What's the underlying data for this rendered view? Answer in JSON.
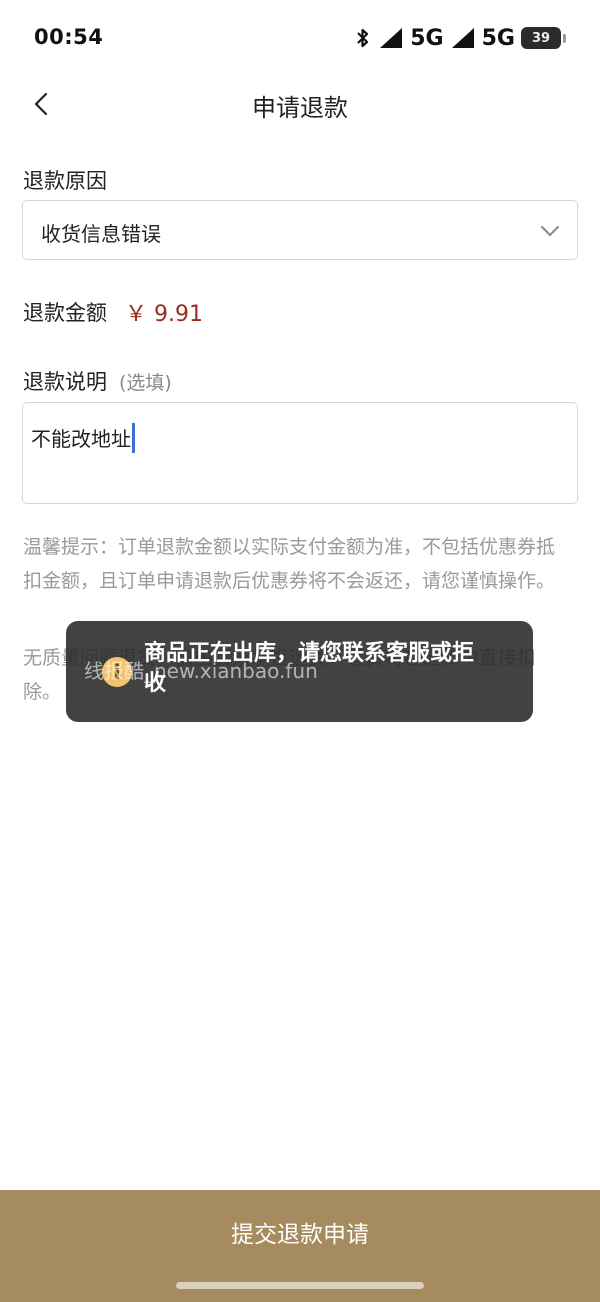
{
  "status_bar": {
    "time": "00:54",
    "network_1": "5G",
    "network_2": "5G",
    "battery_level": "39"
  },
  "header": {
    "title": "申请退款"
  },
  "form": {
    "reason_label": "退款原因",
    "reason_value": "收货信息错误",
    "amount_label": "退款金额",
    "amount_value": "￥ 9.91",
    "note_label": "退款说明",
    "note_optional": "(选填)",
    "note_value": "不能改地址"
  },
  "tips": {
    "tip_1": "温馨提示：订单退款金额以实际支付金额为准，不包括优惠券抵扣金额，且订单申请退款后优惠券将不会返还，请您谨慎操作。",
    "tip_2": "无质量问题退货，需由买家承担运费，运费将在退款中直接扣除。"
  },
  "toast": {
    "message": "商品正在出库，请您联系客服或拒收",
    "watermark": "线报酷_new.xianbao.fun"
  },
  "footer": {
    "submit_label": "提交退款申请"
  },
  "colors": {
    "accent": "#a68b5e",
    "price": "#9c2b22",
    "caret": "#3a6fd8"
  }
}
